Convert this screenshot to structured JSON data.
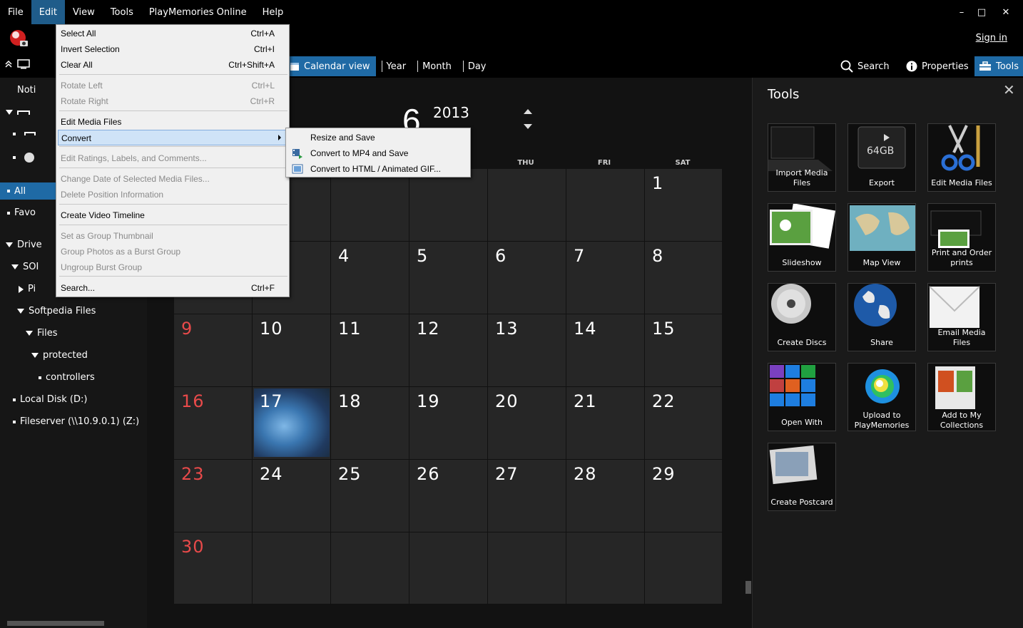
{
  "menubar": {
    "items": [
      "File",
      "Edit",
      "View",
      "Tools",
      "PlayMemories Online",
      "Help"
    ],
    "active": "Edit"
  },
  "window_controls": {
    "minimize": "–",
    "maximize": "□",
    "close": "✕"
  },
  "signin": "Sign in",
  "view_tabs": [
    "Calendar view",
    "Year",
    "Month",
    "Day"
  ],
  "toolbar": {
    "search": "Search",
    "properties": "Properties",
    "tools": "Tools"
  },
  "left_panel": {
    "notifications_truncated": "Noti",
    "all": "All",
    "favorites_truncated": "Favo",
    "drives_truncated": "Drive",
    "sony_truncated": "SOI",
    "pi_truncated": "Pi",
    "softpedia_files": "Softpedia Files",
    "files": "Files",
    "protected": "protected",
    "controllers": "controllers",
    "local_disk": "Local Disk (D:)",
    "fileserver": "Fileserver (\\\\10.9.0.1) (Z:)"
  },
  "calendar": {
    "month": "6",
    "year": "2013",
    "day_headers": [
      "THU",
      "FRI",
      "SAT"
    ],
    "weeks": [
      [
        "",
        "",
        "",
        "",
        "",
        "",
        "1"
      ],
      [
        "",
        "",
        "4",
        "5",
        "6",
        "7",
        "8"
      ],
      [
        "9",
        "10",
        "11",
        "12",
        "13",
        "14",
        "15"
      ],
      [
        "16",
        "17",
        "18",
        "19",
        "20",
        "21",
        "22"
      ],
      [
        "23",
        "24",
        "25",
        "26",
        "27",
        "28",
        "29"
      ],
      [
        "30",
        "",
        "",
        "",
        "",
        "",
        ""
      ]
    ]
  },
  "tools_panel": {
    "title": "Tools",
    "close": "✕",
    "tiles": [
      "Import Media Files",
      "Export",
      "Edit Media Files",
      "Slideshow",
      "Map View",
      "Print and Order prints",
      "Create Discs",
      "Share",
      "Email Media Files",
      "Open With",
      "Upload to PlayMemories",
      "Add to My Collections",
      "Create Postcard"
    ],
    "export_badge": "64GB"
  },
  "edit_menu": {
    "items": [
      {
        "label": "Select All",
        "key": "Ctrl+A",
        "disabled": false
      },
      {
        "label": "Invert Selection",
        "key": "Ctrl+I",
        "disabled": false
      },
      {
        "label": "Clear All",
        "key": "Ctrl+Shift+A",
        "disabled": false
      },
      {
        "label": "Rotate Left",
        "key": "Ctrl+L",
        "disabled": true
      },
      {
        "label": "Rotate Right",
        "key": "Ctrl+R",
        "disabled": true
      },
      {
        "label": "Edit Media Files",
        "key": "",
        "disabled": false
      },
      {
        "label": "Convert",
        "key": "",
        "disabled": false
      },
      {
        "label": "Edit Ratings, Labels, and Comments...",
        "key": "",
        "disabled": true
      },
      {
        "label": "Change Date of Selected Media Files...",
        "key": "",
        "disabled": true
      },
      {
        "label": "Delete Position Information",
        "key": "",
        "disabled": true
      },
      {
        "label": "Create Video Timeline",
        "key": "",
        "disabled": false
      },
      {
        "label": "Set as Group Thumbnail",
        "key": "",
        "disabled": true
      },
      {
        "label": "Group Photos as a Burst Group",
        "key": "",
        "disabled": true
      },
      {
        "label": "Ungroup Burst Group",
        "key": "",
        "disabled": true
      },
      {
        "label": "Search...",
        "key": "Ctrl+F",
        "disabled": false
      }
    ]
  },
  "convert_submenu": {
    "items": [
      "Resize and Save",
      "Convert to MP4 and Save",
      "Convert to HTML / Animated GIF..."
    ]
  },
  "colors": {
    "accent": "#1f6aa5",
    "sunday": "#e84a4a",
    "menu_bg": "#f0f0f0"
  }
}
